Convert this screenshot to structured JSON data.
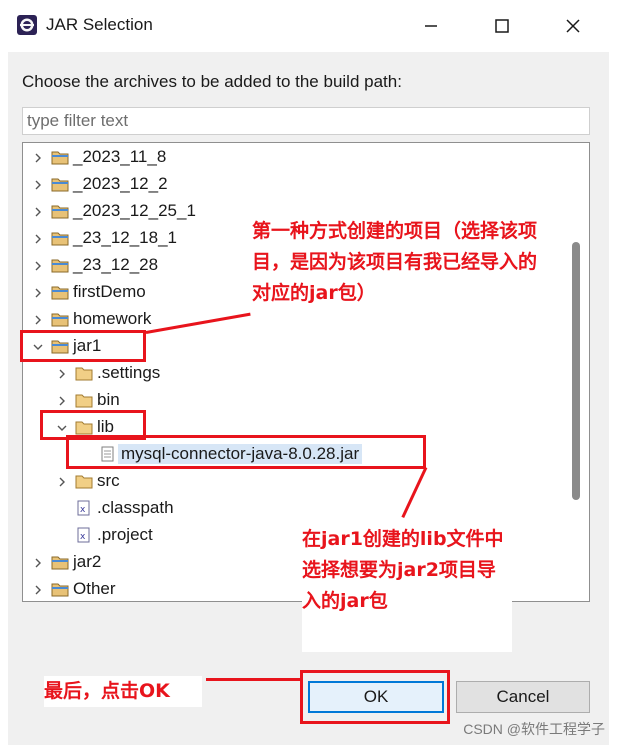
{
  "window": {
    "title": "JAR Selection",
    "prompt": "Choose the archives to be added to the build path:",
    "filter_placeholder": "type filter text"
  },
  "tree": {
    "items": [
      {
        "label": "_2023_11_8",
        "twisty": "collapsed",
        "icon": "project-folder-icon"
      },
      {
        "label": "_2023_12_2",
        "twisty": "collapsed",
        "icon": "project-folder-icon"
      },
      {
        "label": "_2023_12_25_1",
        "twisty": "collapsed",
        "icon": "project-folder-icon"
      },
      {
        "label": "_23_12_18_1",
        "twisty": "collapsed",
        "icon": "project-folder-icon"
      },
      {
        "label": "_23_12_28",
        "twisty": "collapsed",
        "icon": "project-folder-icon"
      },
      {
        "label": "firstDemo",
        "twisty": "collapsed",
        "icon": "project-folder-icon"
      },
      {
        "label": "homework",
        "twisty": "collapsed",
        "icon": "project-folder-icon"
      },
      {
        "label": "jar1",
        "twisty": "expanded",
        "icon": "project-folder-icon"
      },
      {
        "label": ".settings",
        "twisty": "collapsed",
        "icon": "folder-icon"
      },
      {
        "label": "bin",
        "twisty": "collapsed",
        "icon": "folder-icon"
      },
      {
        "label": "lib",
        "twisty": "expanded",
        "icon": "folder-icon"
      },
      {
        "label": "mysql-connector-java-8.0.28.jar",
        "twisty": "none",
        "icon": "jar-file-icon",
        "selected": true
      },
      {
        "label": "src",
        "twisty": "collapsed",
        "icon": "folder-icon"
      },
      {
        "label": ".classpath",
        "twisty": "none",
        "icon": "xml-file-icon"
      },
      {
        "label": ".project",
        "twisty": "none",
        "icon": "xml-file-icon"
      },
      {
        "label": "jar2",
        "twisty": "collapsed",
        "icon": "project-folder-icon"
      },
      {
        "label": "Other",
        "twisty": "collapsed",
        "icon": "project-folder-icon"
      }
    ]
  },
  "buttons": {
    "ok": "OK",
    "cancel": "Cancel"
  },
  "annotations": {
    "note1": "第一种方式创建的项目（选择该项目，是因为该项目有我已经导入的对应的jar包）",
    "note2": "在jar1创建的lib文件中选择想要为jar2项目导入的jar包",
    "note3": "最后，点击OK"
  },
  "watermark": "CSDN @软件工程学子",
  "colors": {
    "annotation": "#e8141c",
    "selection": "#d7e6f6",
    "default_button_border": "#0078d7"
  }
}
